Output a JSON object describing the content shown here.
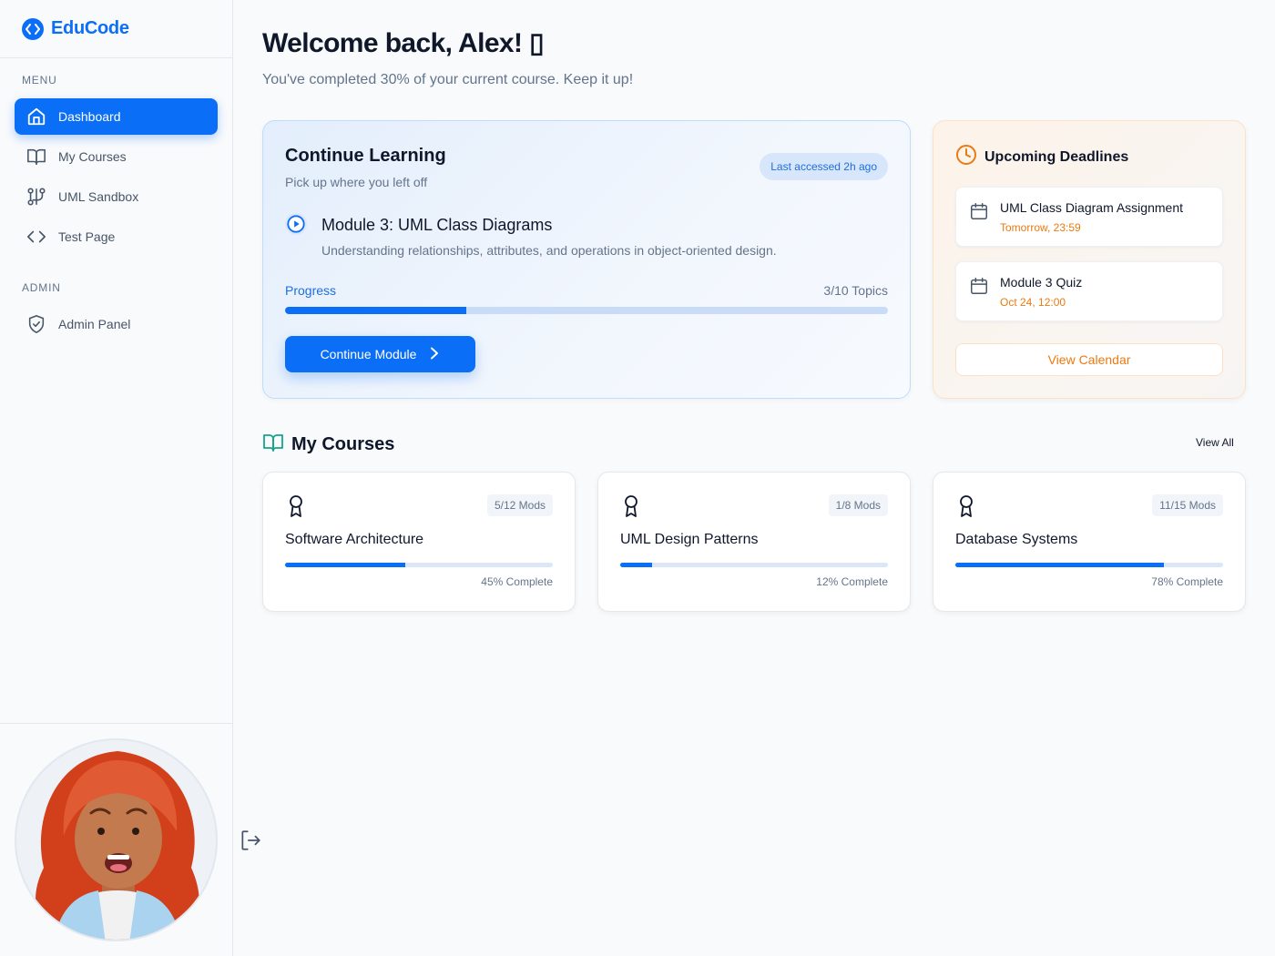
{
  "brand": {
    "name": "EduCode"
  },
  "sidebar": {
    "menu_label": "MENU",
    "admin_label": "ADMIN",
    "items": [
      {
        "label": "Dashboard",
        "icon": "home-icon",
        "active": true
      },
      {
        "label": "My Courses",
        "icon": "book-icon"
      },
      {
        "label": "UML Sandbox",
        "icon": "diagram-icon"
      },
      {
        "label": "Test Page",
        "icon": "code-icon"
      }
    ],
    "admin_items": [
      {
        "label": "Admin Panel",
        "icon": "shield-check-icon"
      }
    ]
  },
  "header": {
    "welcome": "Welcome back, Alex! ▯",
    "subtitle": "You've completed 30% of your current course. Keep it up!"
  },
  "continue_learning": {
    "title": "Continue Learning",
    "subtitle": "Pick up where you left off",
    "badge": "Last accessed 2h ago",
    "module_title": "Module 3: UML Class Diagrams",
    "module_desc": "Understanding relationships, attributes, and operations in object-oriented design.",
    "progress_label": "Progress",
    "progress_count": "3/10 Topics",
    "progress_fraction": 0.3,
    "button_label": "Continue Module"
  },
  "deadlines": {
    "title": "Upcoming Deadlines",
    "items": [
      {
        "name": "UML Class Diagram Assignment",
        "when": "Tomorrow, 23:59"
      },
      {
        "name": "Module 3 Quiz",
        "when": "Oct 24, 12:00"
      }
    ],
    "button_label": "View Calendar"
  },
  "courses": {
    "title": "My Courses",
    "view_all": "View All",
    "items": [
      {
        "name": "Software Architecture",
        "mods": "5/12 Mods",
        "complete": "45% Complete",
        "fraction": 0.45
      },
      {
        "name": "UML Design Patterns",
        "mods": "1/8 Mods",
        "complete": "12% Complete",
        "fraction": 0.12
      },
      {
        "name": "Database Systems",
        "mods": "11/15 Mods",
        "complete": "78% Complete",
        "fraction": 0.78
      }
    ]
  },
  "colors": {
    "accent": "#0b6ef6",
    "warning": "#ea7a12",
    "text": "#0f172a",
    "muted": "#64748b"
  }
}
